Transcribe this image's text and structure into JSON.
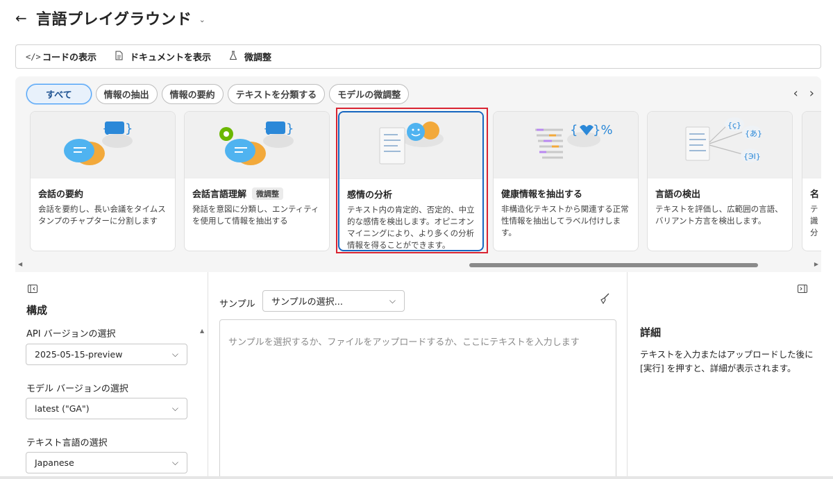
{
  "header": {
    "back_icon": "arrow-left-icon",
    "title": "言語プレイグラウンド",
    "title_chevron": "chevron-down-icon"
  },
  "toolbar": {
    "view_code_label": "コードの表示",
    "view_docs_label": "ドキュメントを表示",
    "fine_tune_label": "微調整"
  },
  "filters": {
    "chips": [
      "すべて",
      "情報の抽出",
      "情報の要約",
      "テキストを分類する",
      "モデルの微調整"
    ],
    "active": "すべて"
  },
  "cards": [
    {
      "title": "会話の要約",
      "badge": "",
      "desc": "会話を要約し、長い会議をタイムスタンプのチャプターに分割します"
    },
    {
      "title": "会話言語理解",
      "badge": "微調整",
      "desc": "発話を意図に分類し、エンティティを使用して情報を抽出する"
    },
    {
      "title": "感情の分析",
      "badge": "",
      "desc": "テキスト内の肯定的、否定的、中立的な感情を検出します。オピニオンマイニングにより、より多くの分析情報を得ることができます。"
    },
    {
      "title": "健康情報を抽出する",
      "badge": "",
      "desc": "非構造化テキストから関連する正常性情報を抽出してラベル付けします。"
    },
    {
      "title": "言語の検出",
      "badge": "",
      "desc": "テキストを評価し、広範囲の言語、バリアント方言を検出します。"
    },
    {
      "title": "名",
      "badge": "",
      "desc": "テ識分"
    }
  ],
  "selected_card": "感情の分析",
  "config": {
    "title": "構成",
    "api_version_label": "API バージョンの選択",
    "api_version_value": "2025-05-15-preview",
    "model_version_label": "モデル バージョンの選択",
    "model_version_value": "latest (\"GA\")",
    "text_language_label": "テキスト言語の選択",
    "text_language_value": "Japanese"
  },
  "input": {
    "sample_label": "サンプル",
    "sample_select_value": "サンプルの選択...",
    "placeholder": "サンプルを選択するか、ファイルをアップロードするか、ここにテキストを入力します"
  },
  "details": {
    "title": "詳細",
    "text": "テキストを入力またはアップロードした後に [実行] を押すと、詳細が表示されます。"
  },
  "colors": {
    "accent": "#1565c0",
    "highlight_frame": "#d92331"
  }
}
